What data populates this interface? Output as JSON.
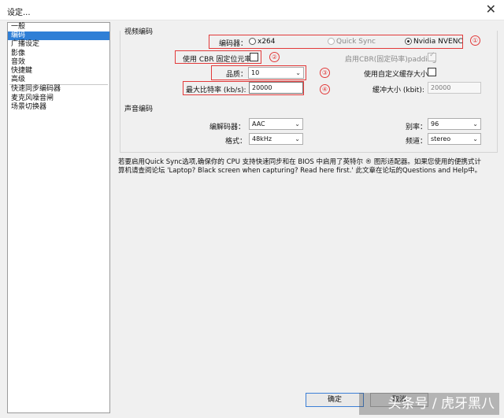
{
  "window": {
    "title": "设定...",
    "close_glyph": "✕"
  },
  "sidebar": {
    "items": [
      {
        "label": "一般",
        "selected": false
      },
      {
        "label": "编码",
        "selected": true
      },
      {
        "label": "广播设定",
        "selected": false
      },
      {
        "label": "影像",
        "selected": false
      },
      {
        "label": "音效",
        "selected": false
      },
      {
        "label": "快捷鍵",
        "selected": false
      },
      {
        "label": "高级",
        "selected": false
      },
      {
        "label": "快速同步编码器",
        "selected": false
      },
      {
        "label": "麦克风噪音闸",
        "selected": false
      },
      {
        "label": "场景切换器",
        "selected": false
      }
    ]
  },
  "video": {
    "legend": "视频编码",
    "encoder_label": "编码器：",
    "encoder_options": [
      {
        "label": "x264",
        "checked": false,
        "enabled": true
      },
      {
        "label": "Quick Sync",
        "checked": false,
        "enabled": false
      },
      {
        "label": "Nvidia NVENC",
        "checked": true,
        "enabled": true
      }
    ],
    "cbr_label": "使用 CBR 固定位元率",
    "cbr_checked": false,
    "cbr_padding_label": "启用CBR(固定码率)padding",
    "cbr_padding_checked": true,
    "quality_label": "品质：",
    "quality_value": "10",
    "custom_buffer_label": "使用自定义缓存大小",
    "custom_buffer_checked": false,
    "max_bitrate_label": "最大比特率 (kb/s):",
    "max_bitrate_value": "20000",
    "buffer_size_label": "缓冲大小 (kbit):",
    "buffer_size_value": "20000"
  },
  "annotations": [
    "①",
    "②",
    "③",
    "④"
  ],
  "audio": {
    "legend": "声音编码",
    "codec_label": "编解码器：",
    "codec_value": "AAC",
    "bitrate_label": "别率：",
    "bitrate_value": "96",
    "format_label": "格式：",
    "format_value": "48kHz",
    "channels_label": "频道：",
    "channels_value": "stereo"
  },
  "note": {
    "line1": "若要启用Quick Sync选项,确保你的 CPU 支持快速同步和在 BIOS 中启用了英特尔 ® 图形适配器。如果您使用的便携式计",
    "line2": "算机请查阅论坛 'Laptop? Black screen when capturing? Read here first.' 此文章在论坛的Questions and Help中。"
  },
  "buttons": {
    "ok": "确定",
    "cancel": "取消"
  },
  "watermark": "头条号 / 虎牙黑八"
}
